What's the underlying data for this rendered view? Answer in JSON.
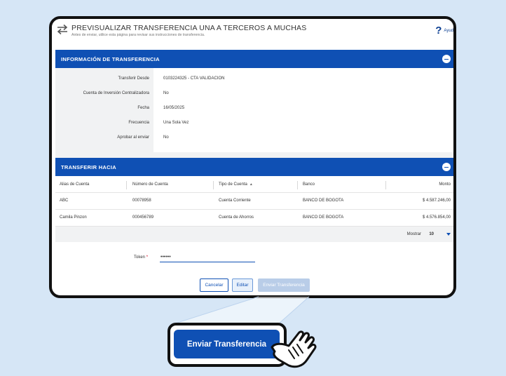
{
  "header": {
    "title": "PREVISUALIZAR TRANSFERENCIA UNA A TERCEROS A MUCHAS",
    "subtitle": "Antes de enviar, utilice esta página para revisar sus instrucciones de transferencia.",
    "help_label": "Ayud"
  },
  "info_section": {
    "title": "INFORMACIÓN DE TRANSFERENCIA",
    "rows": [
      {
        "label": "Transferir Desde",
        "value": "0103224325 - CTA VALIDACION"
      },
      {
        "label": "Cuenta de Inversión Centralizadora",
        "value": "No"
      },
      {
        "label": "Fecha",
        "value": "16/05/2025"
      },
      {
        "label": "Frecuencia",
        "value": "Una Sola Vez"
      },
      {
        "label": "Aprobar al enviar",
        "value": "No"
      }
    ]
  },
  "to_section": {
    "title": "TRANSFERIR HACIA",
    "columns": [
      "Alias de Cuenta",
      "Número de Cuenta",
      "Tipo de Cuenta",
      "Banco",
      "Monto"
    ],
    "rows": [
      {
        "alias": "ABC",
        "account": "00078958",
        "type": "Cuenta Corriente",
        "bank": "BANCO DE BOGOTA",
        "amount": "$ 4.587.246,00"
      },
      {
        "alias": "Camila Pinzon",
        "account": "000456789",
        "type": "Cuenta de Ahorros",
        "bank": "BANCO DE BOGOTA",
        "amount": "$ 4.576.854,00"
      }
    ],
    "pager": {
      "label": "Mostrar",
      "value": "10"
    }
  },
  "token": {
    "label": "Token",
    "required_mark": "*",
    "value": "••••••"
  },
  "buttons": {
    "cancel": "Cancelar",
    "edit": "Editar",
    "send_small": "Enviar Transferencia",
    "send_big": "Enviar Transferencia"
  },
  "colors": {
    "primary": "#0f50b4",
    "background": "#d6e6f6",
    "muted_panel": "#f1f2f3"
  }
}
